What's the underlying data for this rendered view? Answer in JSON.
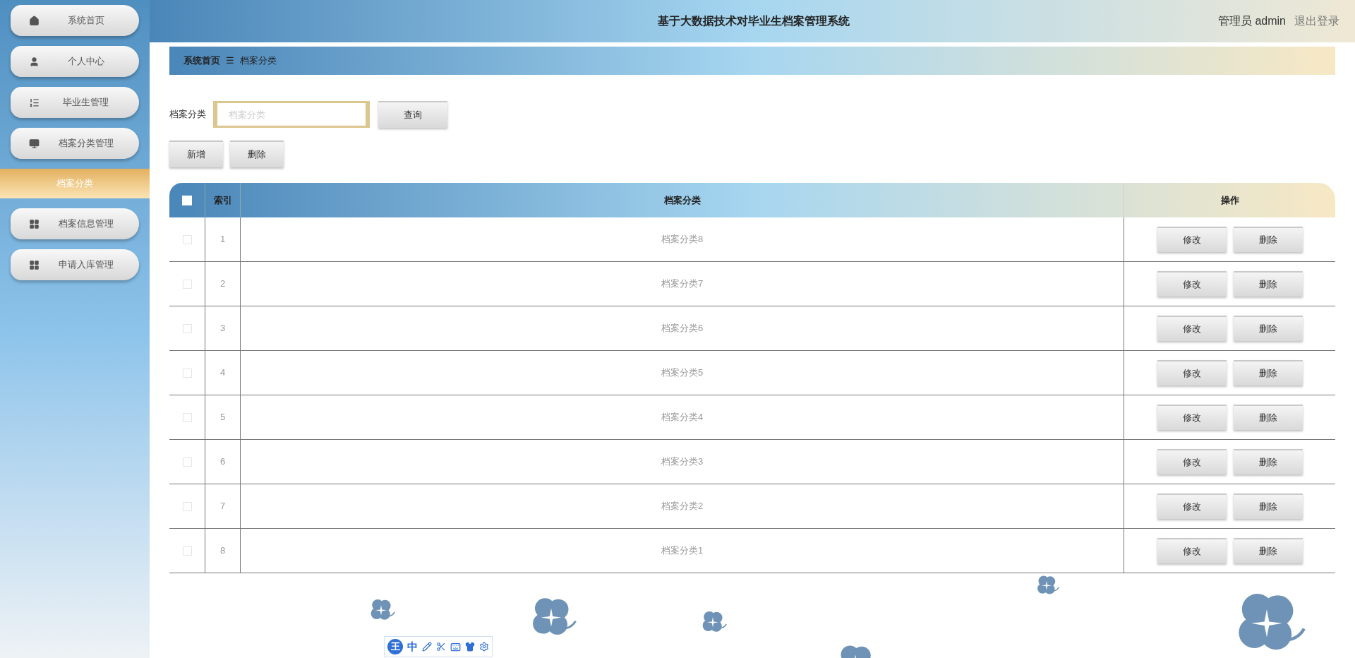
{
  "header": {
    "title": "基于大数据技术对毕业生档案管理系统",
    "user": "管理员 admin",
    "logout": "退出登录"
  },
  "sidebar": {
    "items": [
      {
        "label": "系统首页",
        "kind": "home",
        "selected": false
      },
      {
        "label": "个人中心",
        "kind": "person",
        "selected": false
      },
      {
        "label": "毕业生管理",
        "kind": "list",
        "selected": false
      },
      {
        "label": "档案分类管理",
        "kind": "monitor",
        "selected": false
      },
      {
        "label": "档案分类",
        "kind": "sub",
        "selected": true
      },
      {
        "label": "档案信息管理",
        "kind": "grid",
        "selected": false
      },
      {
        "label": "申请入库管理",
        "kind": "grid",
        "selected": false
      }
    ]
  },
  "breadcrumb": {
    "items": [
      "系统首页",
      "档案分类"
    ],
    "separator": "☰"
  },
  "search": {
    "label": "档案分类",
    "placeholder": "档案分类",
    "button": "查询"
  },
  "actions": [
    "新增",
    "删除"
  ],
  "table": {
    "select_all": false,
    "columns": [
      "索引",
      "档案分类",
      "操作"
    ],
    "rows": [
      {
        "index": "1",
        "name": "档案分类8",
        "checked": false,
        "buttons": [
          "修改",
          "删除"
        ]
      },
      {
        "index": "2",
        "name": "档案分类7",
        "checked": false,
        "buttons": [
          "修改",
          "删除"
        ]
      },
      {
        "index": "3",
        "name": "档案分类6",
        "checked": false,
        "buttons": [
          "修改",
          "删除"
        ]
      },
      {
        "index": "4",
        "name": "档案分类5",
        "checked": false,
        "buttons": [
          "修改",
          "删除"
        ]
      },
      {
        "index": "5",
        "name": "档案分类4",
        "checked": false,
        "buttons": [
          "修改",
          "删除"
        ]
      },
      {
        "index": "6",
        "name": "档案分类3",
        "checked": false,
        "buttons": [
          "修改",
          "删除"
        ]
      },
      {
        "index": "7",
        "name": "档案分类2",
        "checked": false,
        "buttons": [
          "修改",
          "删除"
        ]
      },
      {
        "index": "8",
        "name": "档案分类1",
        "checked": false,
        "buttons": [
          "修改",
          "删除"
        ]
      }
    ]
  },
  "ime_toolbar": {
    "logo": "王",
    "mode": "中"
  }
}
